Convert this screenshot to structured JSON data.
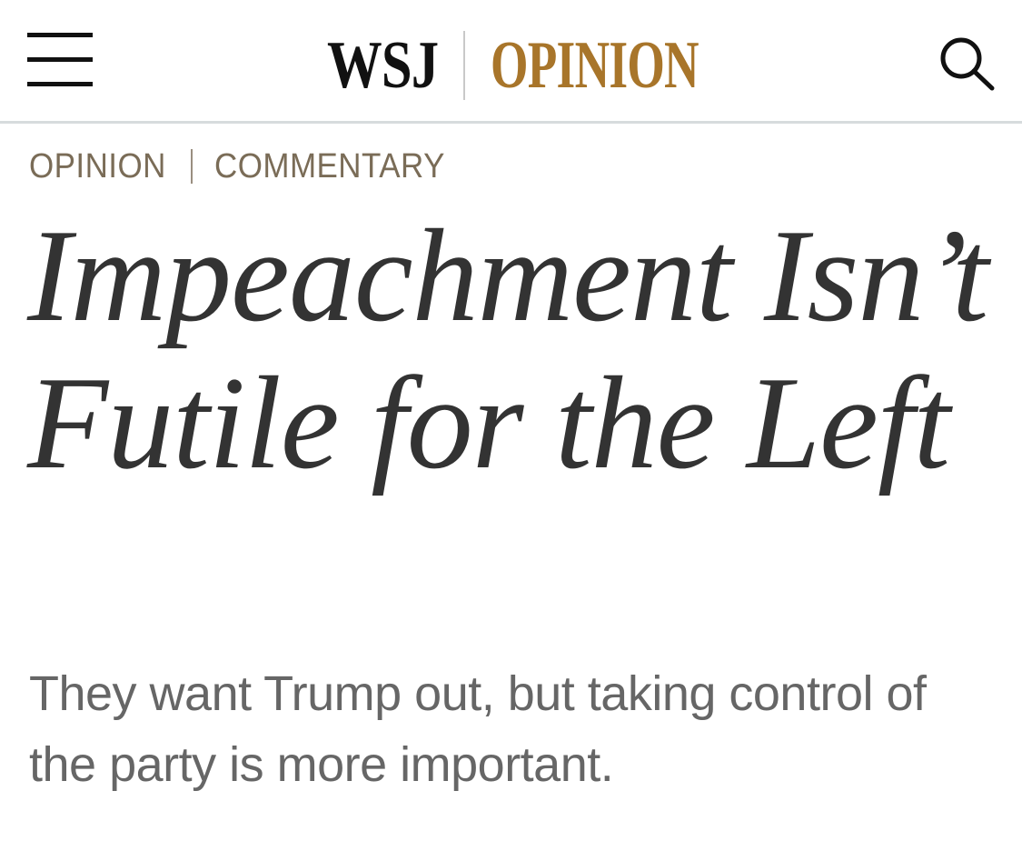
{
  "header": {
    "menu_icon": "hamburger-menu-icon",
    "logo": {
      "brand": "WSJ",
      "section": "OPINION"
    },
    "search_icon": "search-icon",
    "colors": {
      "brand_gold": "#a8752a",
      "divider": "#d7dcdd"
    }
  },
  "breadcrumb": {
    "items": [
      "OPINION",
      "COMMENTARY"
    ],
    "color": "#7a6c57"
  },
  "article": {
    "headline": "Impeachment Isn’t Futile for the Left",
    "dek": "They want Trump out, but taking control of the party is more important."
  }
}
